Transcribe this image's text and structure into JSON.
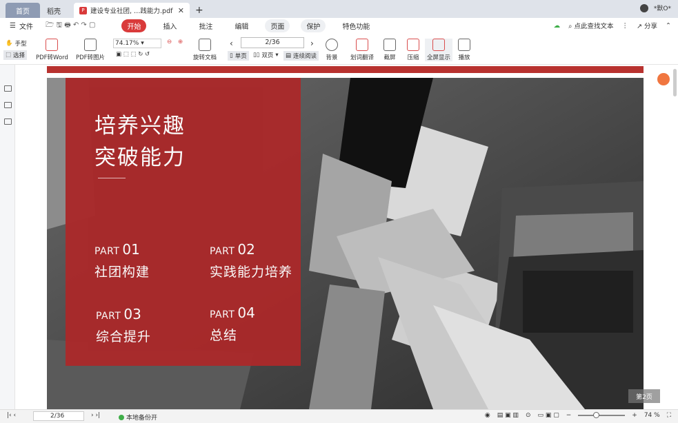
{
  "tabs": {
    "home": "首页",
    "daoke": "稻壳",
    "doc": "建设专业社团, …践能力.pdf"
  },
  "title_right": {
    "user": "*默O*"
  },
  "menu": {
    "file": "文件",
    "tabs": [
      "开始",
      "插入",
      "批注",
      "编辑",
      "页面",
      "保护",
      "特色功能"
    ],
    "search": "点此查找文本",
    "share": "分享"
  },
  "toolbar": {
    "hand": "手型",
    "select": "选择",
    "pdf2word": "PDF转Word",
    "pdf2img": "PDF转图片",
    "zoom": "74.17%",
    "rotate": "旋转文档",
    "page": "2/36",
    "single": "单页",
    "double": "双页",
    "continuous": "连续阅读",
    "bg": "背景",
    "translate": "划词翻译",
    "screenshot": "截屏",
    "compress": "压缩",
    "fullscreen": "全屏显示",
    "play": "播放"
  },
  "slide": {
    "title1": "培养兴趣",
    "title2": "突破能力",
    "parts": [
      {
        "p": "PART",
        "n": "01",
        "t": "社团构建"
      },
      {
        "p": "PART",
        "n": "02",
        "t": "实践能力培养"
      },
      {
        "p": "PART",
        "n": "03",
        "t": "综合提升"
      },
      {
        "p": "PART",
        "n": "04",
        "t": "总结"
      }
    ],
    "badge": "第2页"
  },
  "status": {
    "page": "2/36",
    "backup": "本地备份开",
    "zoom": "74 %"
  }
}
